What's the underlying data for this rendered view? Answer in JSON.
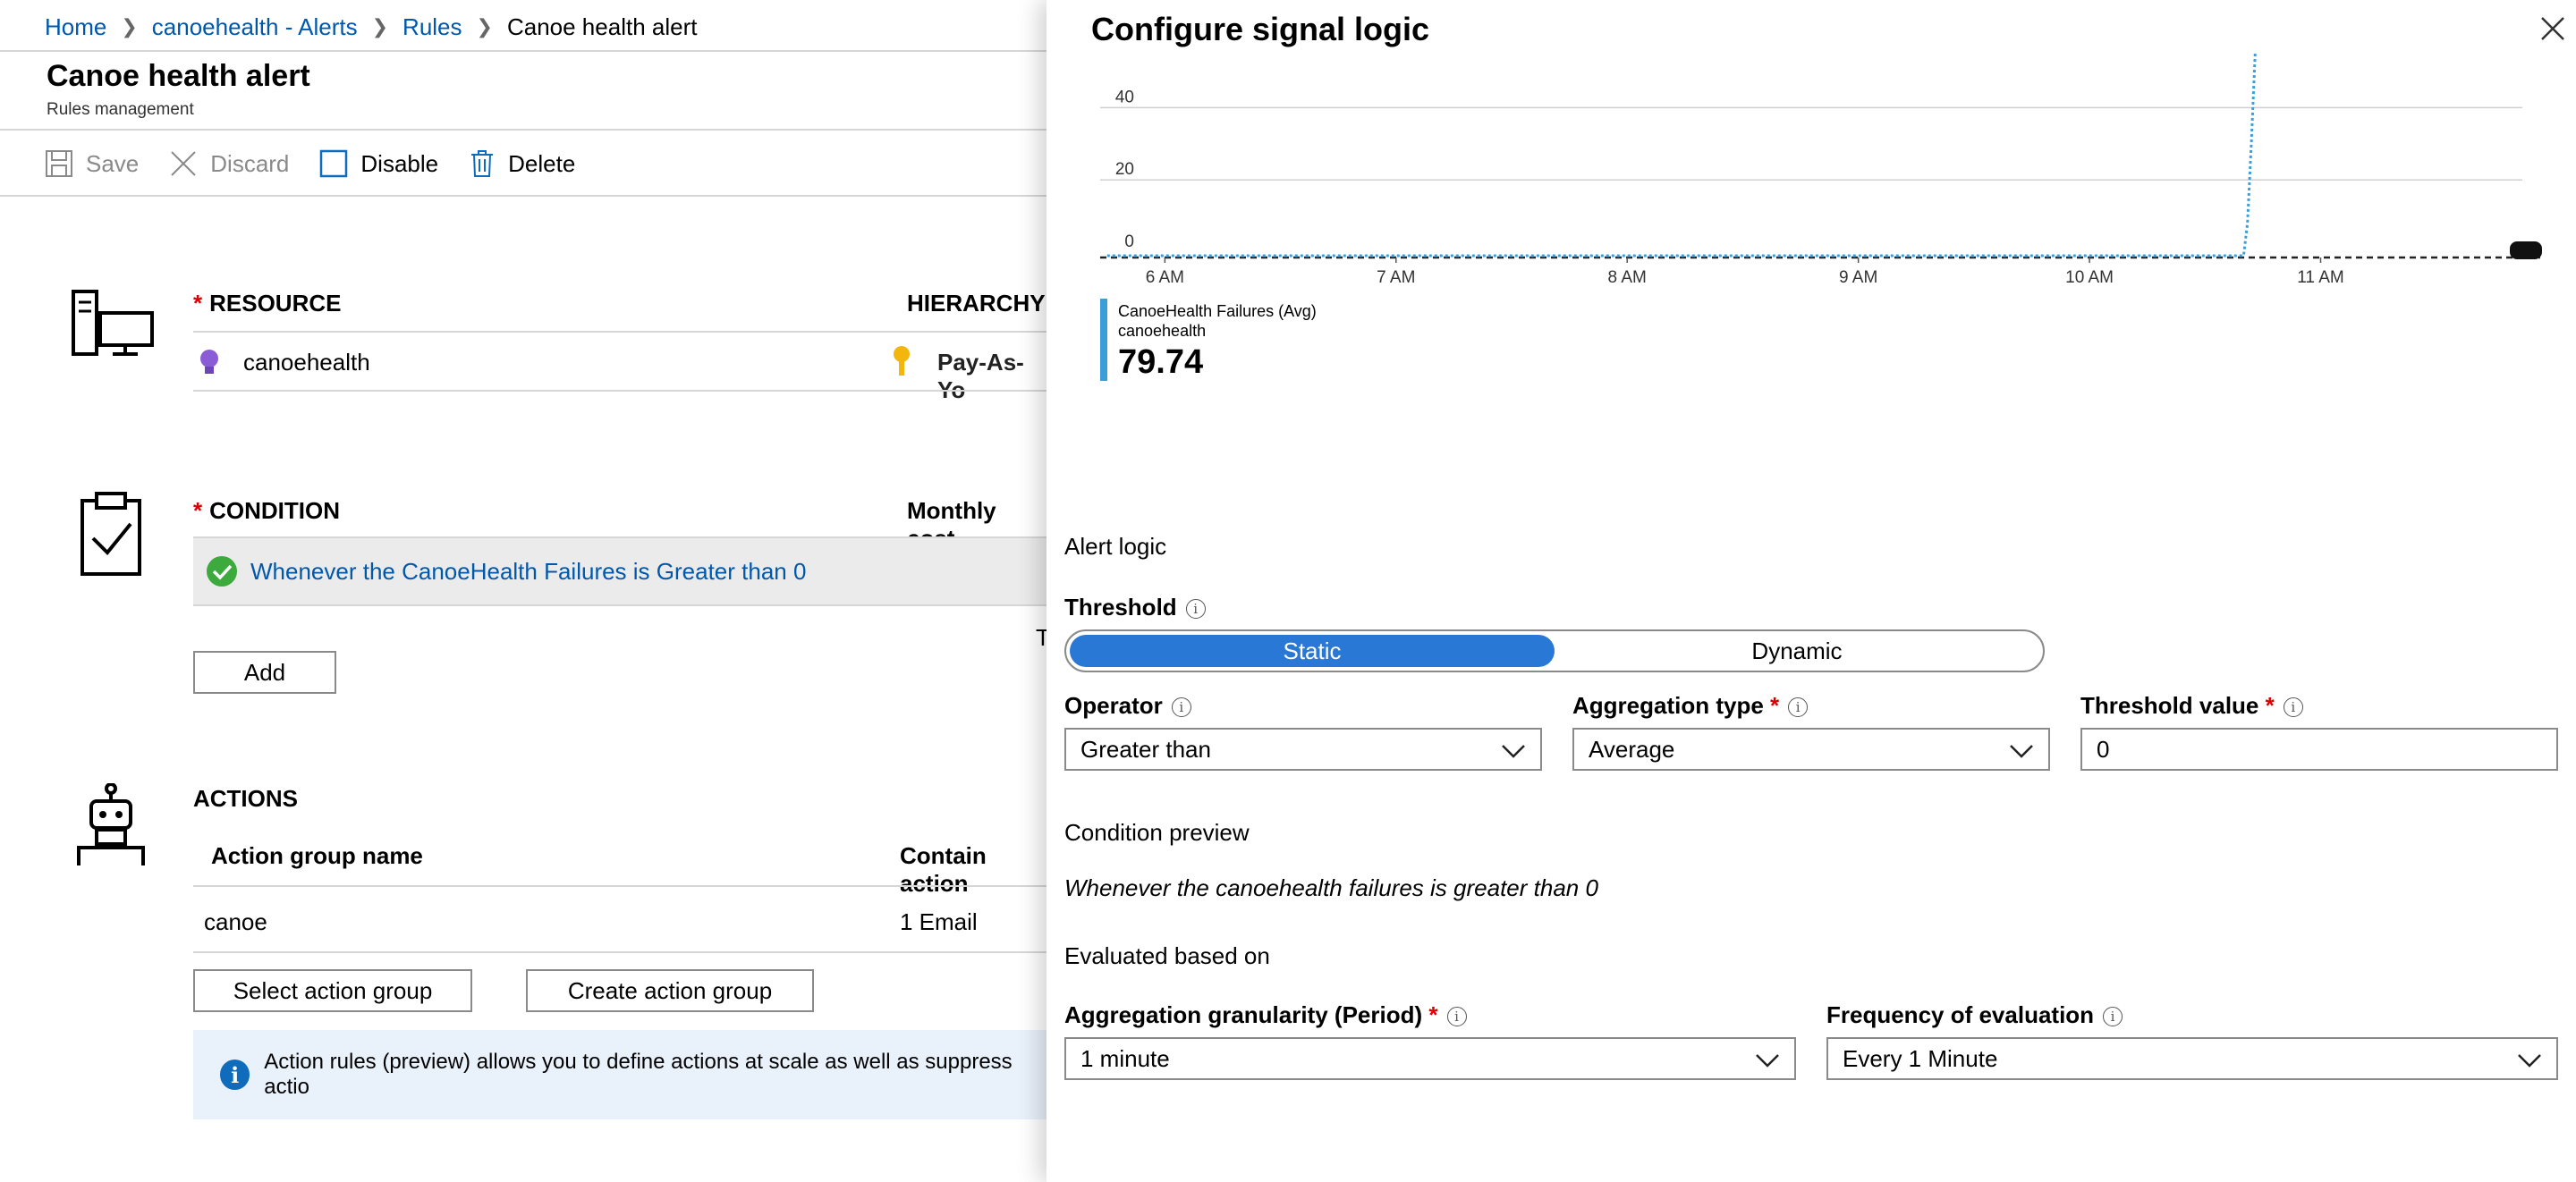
{
  "breadcrumb": {
    "home": "Home",
    "alerts": "canoehealth - Alerts",
    "rules": "Rules",
    "current": "Canoe health alert"
  },
  "page": {
    "title": "Canoe health alert",
    "subtitle": "Rules management"
  },
  "toolbar": {
    "save": "Save",
    "discard": "Discard",
    "disable": "Disable",
    "delete": "Delete"
  },
  "resource": {
    "heading": "RESOURCE",
    "hierarchy_heading": "HIERARCHY",
    "name": "canoehealth",
    "hierarchy_value": "Pay-As-Yo"
  },
  "condition": {
    "heading": "CONDITION",
    "monthly_cost_heading": "Monthly cost",
    "text": "Whenever the CanoeHealth Failures is Greater than 0",
    "truncated": "T",
    "add_label": "Add"
  },
  "actions": {
    "heading": "ACTIONS",
    "col_name": "Action group name",
    "col_contain": "Contain action",
    "rows": [
      {
        "name": "canoe",
        "contain": "1 Email"
      }
    ],
    "select_label": "Select action group",
    "create_label": "Create action group",
    "info": "Action rules (preview) allows you to define actions at scale as well as suppress actio"
  },
  "panel": {
    "title": "Configure signal logic",
    "chart_data": {
      "type": "line",
      "y_ticks": [
        "0",
        "20",
        "40"
      ],
      "ylim": [
        0,
        50
      ],
      "x_ticks": [
        "6 AM",
        "7 AM",
        "8 AM",
        "9 AM",
        "10 AM",
        "11 AM"
      ],
      "series": [
        {
          "name": "CanoeHealth Failures (Avg)",
          "x": [
            "5:45 AM",
            "6 AM",
            "7 AM",
            "8 AM",
            "9 AM",
            "10 AM",
            "10:40 AM",
            "10:41 AM",
            "10:42 AM",
            "10:43 AM"
          ],
          "values": [
            0,
            0,
            0,
            0,
            0,
            0,
            0,
            8,
            30,
            55
          ]
        }
      ],
      "threshold": 0,
      "legend_resource": "canoehealth",
      "legend_value": "79.74"
    },
    "alert_logic": "Alert logic",
    "threshold": {
      "label": "Threshold",
      "options": [
        "Static",
        "Dynamic"
      ],
      "selected": "Static"
    },
    "operator": {
      "label": "Operator",
      "value": "Greater than"
    },
    "aggregation_type": {
      "label": "Aggregation type",
      "value": "Average"
    },
    "threshold_value": {
      "label": "Threshold value",
      "value": "0"
    },
    "condition_preview": {
      "label": "Condition preview",
      "text": "Whenever the canoehealth failures is greater than 0"
    },
    "evaluated": "Evaluated based on",
    "granularity": {
      "label": "Aggregation granularity (Period)",
      "value": "1 minute"
    },
    "frequency": {
      "label": "Frequency of evaluation",
      "value": "Every 1 Minute"
    },
    "colors": {
      "accent": "#2a78d6",
      "series": "#3a9fd9",
      "link": "#0058ad",
      "required": "#dd0000"
    }
  }
}
